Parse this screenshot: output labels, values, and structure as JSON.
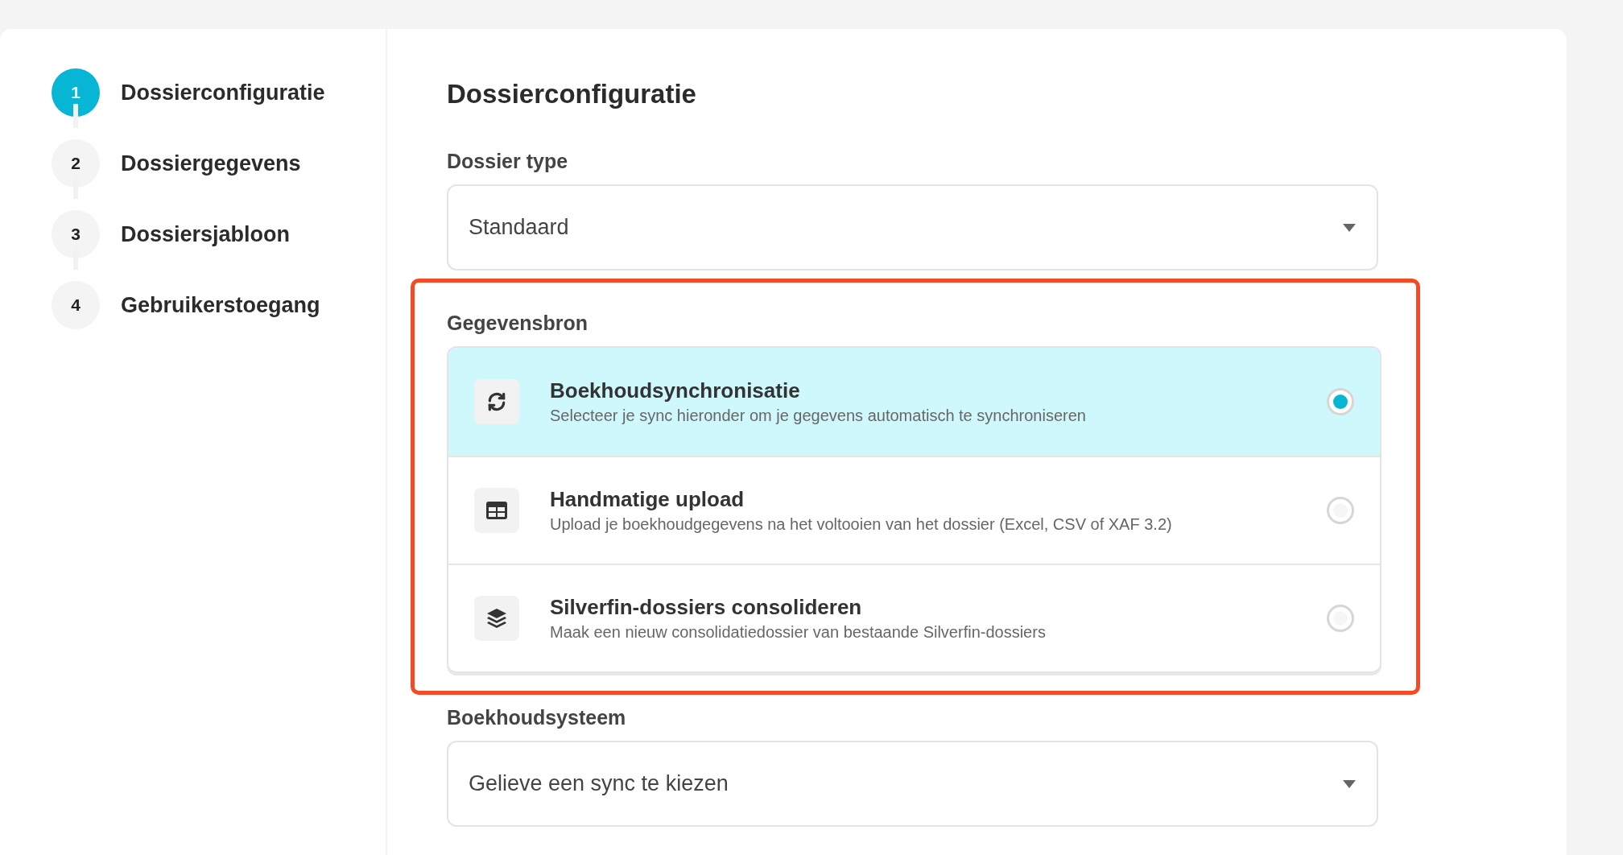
{
  "steps": [
    {
      "number": "1",
      "label": "Dossierconfiguratie",
      "selected": true
    },
    {
      "number": "2",
      "label": "Dossiergegevens",
      "selected": false
    },
    {
      "number": "3",
      "label": "Dossiersjabloon",
      "selected": false
    },
    {
      "number": "4",
      "label": "Gebruikerstoegang",
      "selected": false
    }
  ],
  "title": "Dossierconfiguratie",
  "dossier_type": {
    "label": "Dossier type",
    "value": "Standaard"
  },
  "data_source": {
    "label": "Gegevensbron",
    "highlighted": true,
    "options": [
      {
        "kind": "sync",
        "title": "Boekhoudsynchronisatie",
        "description": "Selecteer je sync hieronder om je gegevens automatisch te synchroniseren",
        "selected": true
      },
      {
        "kind": "table",
        "title": "Handmatige upload",
        "description": "Upload je boekhoudgegevens na het voltooien van het dossier (Excel, CSV of XAF 3.2)",
        "selected": false
      },
      {
        "kind": "layers",
        "title": "Silverfin-dossiers consolideren",
        "description": "Maak een nieuw consolidatiedossier van bestaande Silverfin-dossiers",
        "selected": false
      }
    ]
  },
  "accounting_system": {
    "label": "Boekhoudsysteem",
    "placeholder": "Gelieve een sync te kiezen"
  }
}
